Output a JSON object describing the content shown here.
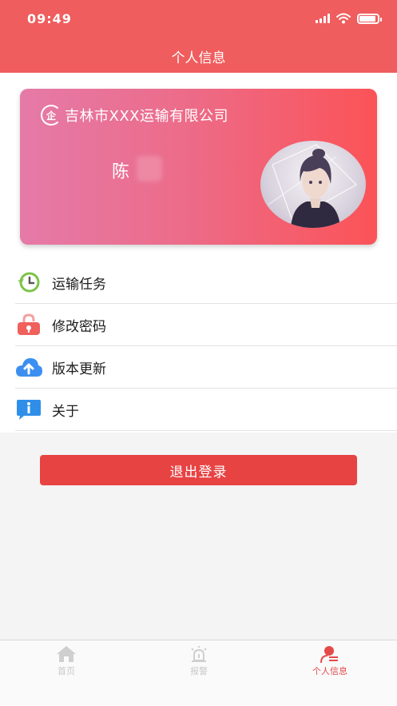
{
  "status_bar": {
    "time": "09:49",
    "battery_level": 0.9
  },
  "header": {
    "title": "个人信息"
  },
  "card": {
    "company_logo_text": "企",
    "company_name": "吉林市XXX运输有限公司",
    "user_name": "陈"
  },
  "menu": {
    "items": [
      {
        "label": "运输任务",
        "icon": "clock-return-icon"
      },
      {
        "label": "修改密码",
        "icon": "lock-icon"
      },
      {
        "label": "版本更新",
        "icon": "cloud-upload-icon"
      },
      {
        "label": "关于",
        "icon": "info-icon"
      }
    ]
  },
  "logout_label": "退出登录",
  "tabbar": {
    "tabs": [
      {
        "label": "首页",
        "icon": "home-icon",
        "active": false
      },
      {
        "label": "报警",
        "icon": "alarm-icon",
        "active": false
      },
      {
        "label": "个人信息",
        "icon": "person-icon",
        "active": true
      }
    ]
  },
  "colors": {
    "header": "#ef5d5e",
    "accent": "#e84343",
    "active_tab": "#e54a4a"
  }
}
